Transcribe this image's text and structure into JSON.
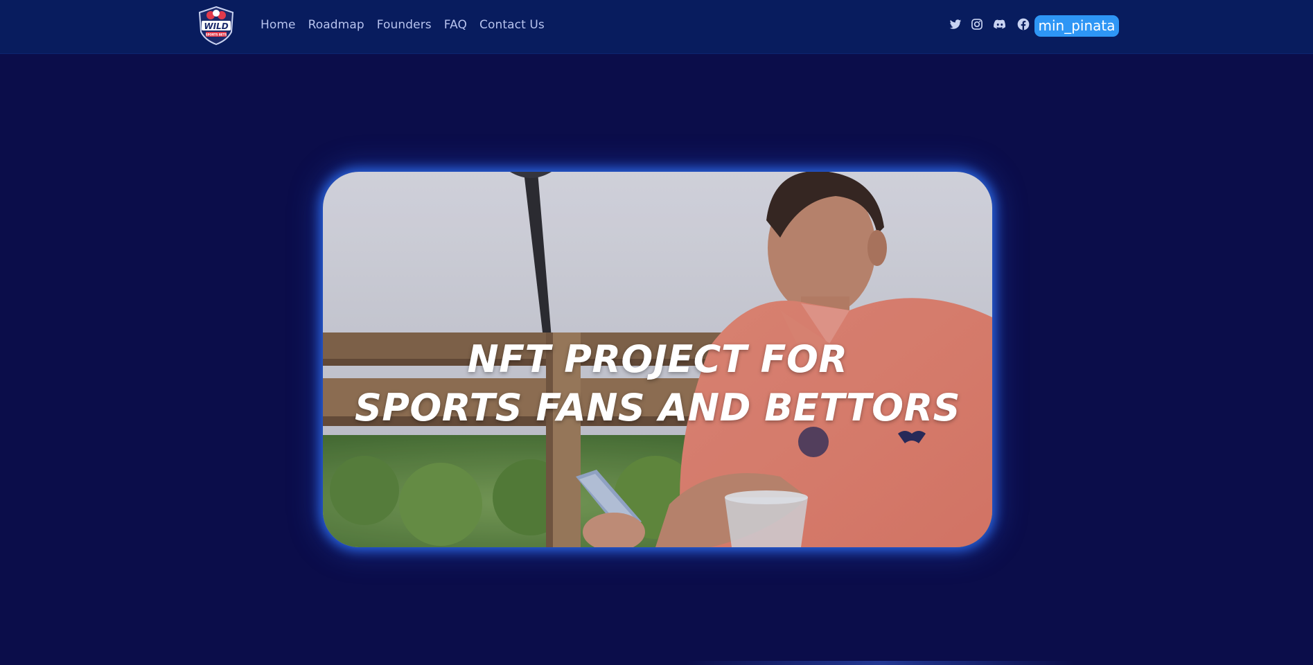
{
  "brand": {
    "logo_text": "WILD",
    "logo_subtext": "SPORTS BETS"
  },
  "nav": {
    "items": [
      {
        "label": "Home"
      },
      {
        "label": "Roadmap"
      },
      {
        "label": "Founders"
      },
      {
        "label": "FAQ"
      },
      {
        "label": "Contact Us"
      }
    ]
  },
  "social": [
    "twitter-icon",
    "instagram-icon",
    "discord-icon",
    "facebook-icon"
  ],
  "user": {
    "username": "min_pinata"
  },
  "hero": {
    "title_line1": "NFT PROJECT FOR",
    "title_line2": "SPORTS FANS AND BETTORS"
  },
  "colors": {
    "page_bg": "#0b0d4a",
    "navbar_bg": "#081c5e",
    "nav_text": "#b7c3ee",
    "accent": "#2e96f5",
    "hero_glow": "#2e6ef0"
  }
}
